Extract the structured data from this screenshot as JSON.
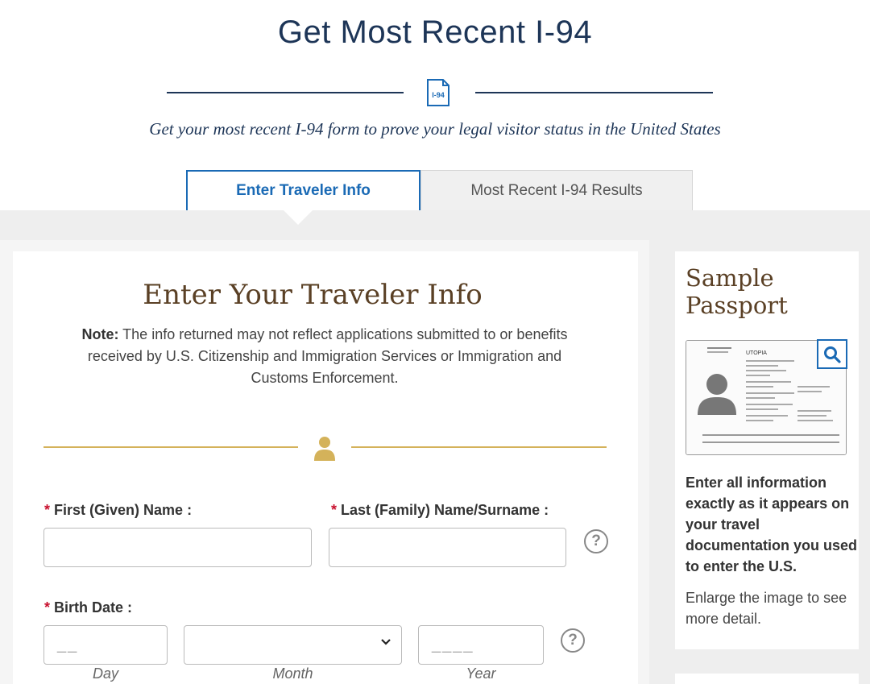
{
  "page_title": "Get Most Recent I-94",
  "header_icon_label": "I-94",
  "subtitle": "Get your most recent I-94 form to prove your legal visitor status in the United States",
  "tabs": [
    {
      "label": "Enter Traveler Info",
      "active": true
    },
    {
      "label": "Most Recent I-94 Results",
      "active": false
    }
  ],
  "form": {
    "title": "Enter Your Traveler Info",
    "note_bold": "Note:",
    "note_text": " The info returned may not reflect applications submitted to or benefits received by U.S. Citizenship and Immigration Services or Immigration and Customs Enforcement.",
    "required_marker": "*",
    "first_name_label": "First (Given) Name :",
    "last_name_label": "Last (Family) Name/Surname :",
    "birth_date_label": "Birth Date :",
    "day_placeholder": "__",
    "year_placeholder": "____",
    "day_label": "Day",
    "month_label": "Month",
    "year_label": "Year",
    "help_symbol": "?"
  },
  "sidebar": {
    "title": "Sample Passport",
    "passport_country": "UTOPIA",
    "instructions": "Enter all information exactly as it appears on your travel documentation you used to enter the U.S.",
    "enlarge_text": "Enlarge the image to see more detail."
  },
  "colors": {
    "navy": "#1d3557",
    "blue": "#1a6ab5",
    "gold": "#d4b25a",
    "brown": "#5a4025",
    "required_red": "#c8102e"
  }
}
